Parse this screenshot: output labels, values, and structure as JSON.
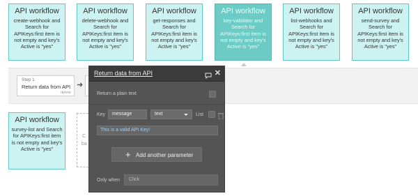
{
  "workflows": [
    {
      "title": "API workflow",
      "desc": "create-webhook and Search for APIKeys:first item is not empty and key's Active is \"yes\""
    },
    {
      "title": "API workflow",
      "desc": "delete-webhook and Search for APIKeys:first item is not empty and key's Active is \"yes\""
    },
    {
      "title": "API workflow",
      "desc": "get-responses and Search for APIKeys:first item is not empty and key's Active is \"yes\""
    },
    {
      "title": "API workflow",
      "desc": "key-validator and Search for APIKeys:first item is not empty and key's Active is \"yes\"",
      "active": true
    },
    {
      "title": "API workflow",
      "desc": "list-webhooks and Search for APIKeys:first item is not empty and key's Active is \"yes\""
    },
    {
      "title": "API workflow",
      "desc": "send-survey and Search for APIKeys:first item is not empty and key's Active is \"yes\""
    },
    {
      "title": "API workflow",
      "desc": "survey-list and Search for APIKeys:first item is not empty and key's Active is \"yes\""
    }
  ],
  "step": {
    "number": "Step 1",
    "name": "Return data from API",
    "delete": "delete"
  },
  "dashed": {
    "line1": "C",
    "line2": "ba"
  },
  "panel": {
    "title": "Return data from API",
    "plain_text_label": "Return a plain text",
    "key_label": "Key",
    "key_value": "message",
    "type_value": "text",
    "list_label": "List",
    "value_text": "This is a valid API Key!",
    "add_param_label": "Add another parameter",
    "only_when_label": "Only when",
    "only_when_placeholder": "Click"
  },
  "colors": {
    "card_bg": "#ccf3f1",
    "card_active_bg": "#6ccbc4",
    "panel_bg": "#545454",
    "value_text": "#9fd0ff"
  },
  "icons": {
    "comment": "comment-icon",
    "close": "close-icon",
    "trash": "trash-icon",
    "plus": "plus-icon",
    "arrow": "arrow-right-icon"
  }
}
